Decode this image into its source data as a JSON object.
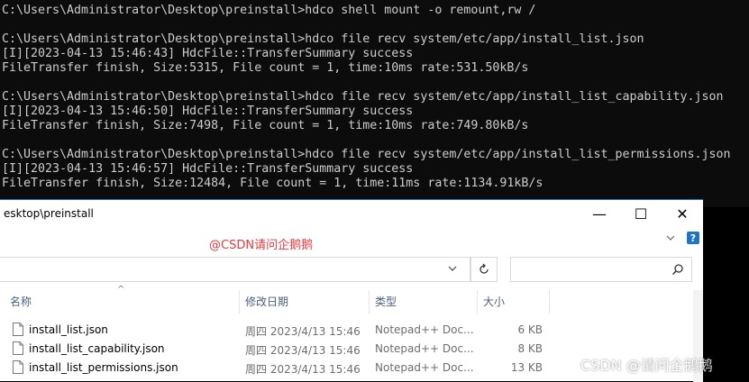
{
  "console": {
    "lines": [
      "C:\\Users\\Administrator\\Desktop\\preinstall>hdco shell mount -o remount,rw /",
      "",
      "C:\\Users\\Administrator\\Desktop\\preinstall>hdco file recv system/etc/app/install_list.json",
      "[I][2023-04-13 15:46:43] HdcFile::TransferSummary success",
      "FileTransfer finish, Size:5315, File count = 1, time:10ms rate:531.50kB/s",
      "",
      "C:\\Users\\Administrator\\Desktop\\preinstall>hdco file recv system/etc/app/install_list_capability.json",
      "[I][2023-04-13 15:46:50] HdcFile::TransferSummary success",
      "FileTransfer finish, Size:7498, File count = 1, time:10ms rate:749.80kB/s",
      "",
      "C:\\Users\\Administrator\\Desktop\\preinstall>hdco file recv system/etc/app/install_list_permissions.json",
      "[I][2023-04-13 15:46:57] HdcFile::TransferSummary success",
      "FileTransfer finish, Size:12484, File count = 1, time:11ms rate:1134.91kB/s"
    ]
  },
  "explorer": {
    "title": "esktop\\preinstall",
    "window_controls": {
      "minimize": "—",
      "maximize": "☐",
      "close": "✕"
    },
    "watermark_top": "@CSDN请问企鹅鹅",
    "help": "?",
    "columns": {
      "name": "名称",
      "date": "修改日期",
      "type": "类型",
      "size": "大小"
    },
    "files": [
      {
        "name": "install_list.json",
        "date": "周四 2023/4/13 15:46",
        "type": "Notepad++ Doc...",
        "size": "6 KB"
      },
      {
        "name": "install_list_capability.json",
        "date": "周四 2023/4/13 15:46",
        "type": "Notepad++ Doc...",
        "size": "8 KB"
      },
      {
        "name": "install_list_permissions.json",
        "date": "周四 2023/4/13 15:46",
        "type": "Notepad++ Doc...",
        "size": "13 KB"
      }
    ]
  },
  "watermark_bottom": "CSDN @请问企鹅鹅",
  "colors": {
    "console_bg": "#0c0c0c",
    "console_fg": "#cccccc",
    "accent": "#1e73c8",
    "watermark_red": "#e4393c"
  }
}
